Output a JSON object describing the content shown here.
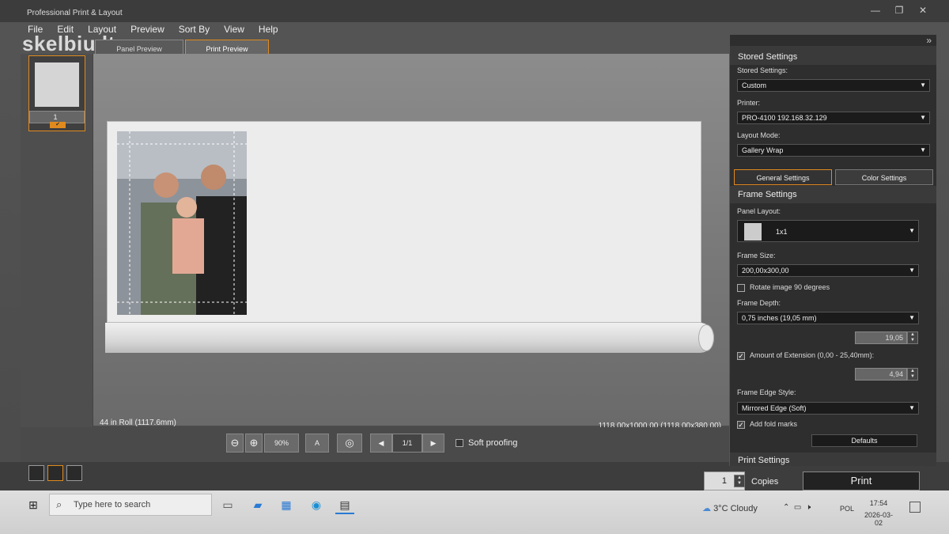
{
  "window": {
    "title": "Professional Print & Layout",
    "minimize": "—",
    "restore": "❐",
    "close": "✕"
  },
  "watermark": "skelbiu.lt",
  "menu": [
    "File",
    "Edit",
    "Layout",
    "Preview",
    "Sort By",
    "View",
    "Help"
  ],
  "tabs": [
    "Panel Preview",
    "Print Preview"
  ],
  "thumbnail": {
    "number": "1",
    "check": "✔"
  },
  "canvas": {
    "roll_label": "44 in Roll (1117.6mm)",
    "dimensions": "1118,00x1000,00 (1118,00x380,00)"
  },
  "toolbar": {
    "zoom_out": "⊖",
    "zoom_in": "⊕",
    "zoom": "90%",
    "page": "1/1",
    "soft_proofing": "Soft proofing",
    "prev": "◀",
    "next": "▶",
    "font_icon": "A",
    "spiral_icon": "◎"
  },
  "copies": {
    "value": "1",
    "label": "Copies"
  },
  "print_button": "Print",
  "right_panel": {
    "collapse_arrows": "»",
    "stored_header": "Stored Settings",
    "stored_label": "Stored Settings:",
    "stored_value": "Custom",
    "printer_label": "Printer:",
    "printer_value": "PRO-4100 192.168.32.129",
    "layout_mode_label": "Layout Mode:",
    "layout_mode_value": "Gallery Wrap",
    "tab_general": "General Settings",
    "tab_color": "Color Settings",
    "frame_header": "Frame Settings",
    "panel_layout_label": "Panel Layout:",
    "panel_layout_value": "1x1",
    "frame_size_label": "Frame Size:",
    "frame_size_value": "200,00x300,00",
    "rotate_label": "Rotate image 90 degrees",
    "frame_depth_label": "Frame Depth:",
    "frame_depth_value": "0,75 inches (19,05 mm)",
    "frame_depth_num": "19,05",
    "extension_label": "Amount of Extension (0,00 - 25,40mm):",
    "extension_num": "4,94",
    "edge_style_label": "Frame Edge Style:",
    "edge_style_value": "Mirrored Edge (Soft)",
    "fold_marks_label": "Add fold marks",
    "defaults": "Defaults",
    "print_settings_header": "Print Settings"
  },
  "taskbar": {
    "search": "Type here to search",
    "weather": "3°C  Cloudy",
    "lang": "POL",
    "time": "17:54",
    "date": "2026-03-02"
  },
  "accent": "#e08a1e"
}
